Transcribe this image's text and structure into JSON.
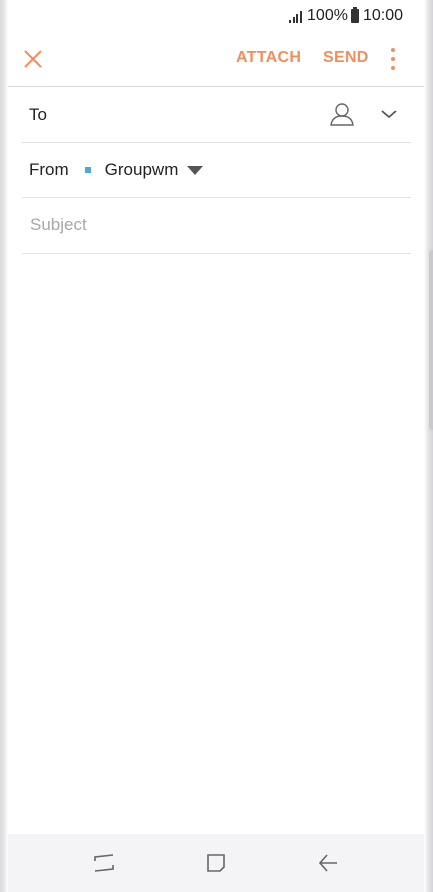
{
  "status_bar": {
    "battery": "100%",
    "time": "10:00",
    "icons": [
      "signal-icon",
      "battery-icon"
    ]
  },
  "app_bar": {
    "close_icon": "close-icon",
    "attach_label": "ATTACH",
    "send_label": "SEND",
    "more_icon": "more-vert-icon",
    "accent_color": "#f08f5c"
  },
  "compose": {
    "to_label": "To",
    "to_value": "",
    "contact_icon": "contact-person-icon",
    "expand_icon": "chevron-down-icon",
    "from_label": "From",
    "from_account": "Groupwm",
    "account_color": "#4aa9d6",
    "subject_placeholder": "Subject",
    "subject_value": "",
    "body_value": ""
  },
  "nav_bar": {
    "items": [
      "recent-apps-icon",
      "home-icon",
      "back-icon"
    ]
  }
}
